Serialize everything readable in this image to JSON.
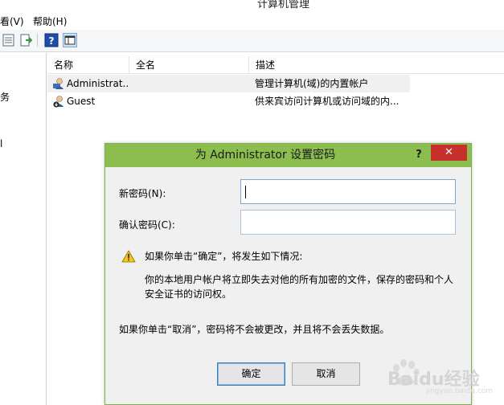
{
  "window": {
    "title": "计算机管理"
  },
  "menubar": {
    "view": "看(V)",
    "help": "帮助(H)"
  },
  "leftpane": {
    "fragments": [
      "务",
      "l"
    ]
  },
  "columns": {
    "name": "名称",
    "fullname": "全名",
    "description": "描述"
  },
  "users": [
    {
      "name": "Administrat...",
      "fullname": "",
      "description": "管理计算机(域)的内置帐户"
    },
    {
      "name": "Guest",
      "fullname": "",
      "description": "供来宾访问计算机或访问域的内..."
    }
  ],
  "dialog": {
    "title": "为 Administrator 设置密码",
    "help": "?",
    "close": "✕",
    "new_password_label": "新密码(N):",
    "new_password_value": "",
    "confirm_password_label": "确认密码(C):",
    "confirm_password_value": "",
    "warning_heading": "如果你单击“确定”，将发生如下情况:",
    "warning_line1": "你的本地用户帐户将立即失去对他的所有加密的文件，保存的密码和个人",
    "warning_line2": "安全证书的访问权。",
    "cancel_note": "如果你单击“取消”，密码将不会被更改，并且将不会丢失数据。",
    "ok_label": "确定",
    "cancel_label": "取消"
  },
  "watermark": {
    "text": "Baidu经验",
    "sub": "jingyan.baidu.com"
  },
  "colors": {
    "dialog_titlebar": "#8cbd4f",
    "close_button": "#c7302b",
    "selection": "#f0f0f0"
  }
}
